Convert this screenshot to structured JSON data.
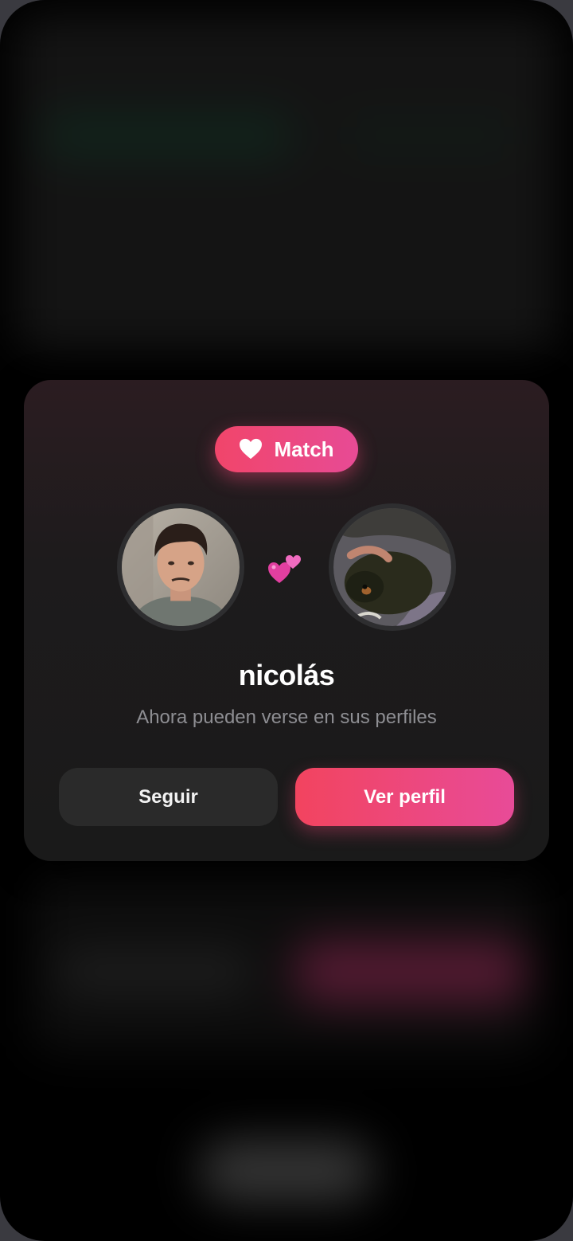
{
  "modal": {
    "badge_label": "Match",
    "user_name": "nicolás",
    "subtitle": "Ahora pueden verse en sus perfiles",
    "follow_button_label": "Seguir",
    "profile_button_label": "Ver perfil"
  },
  "icons": {
    "badge": "heart-icon",
    "between_avatars": "two-hearts-icon"
  },
  "colors": {
    "accent_start": "#f1456a",
    "accent_end": "#e74b95",
    "card_background": "#1a1a1a",
    "subtitle_text": "#8e8e93"
  }
}
